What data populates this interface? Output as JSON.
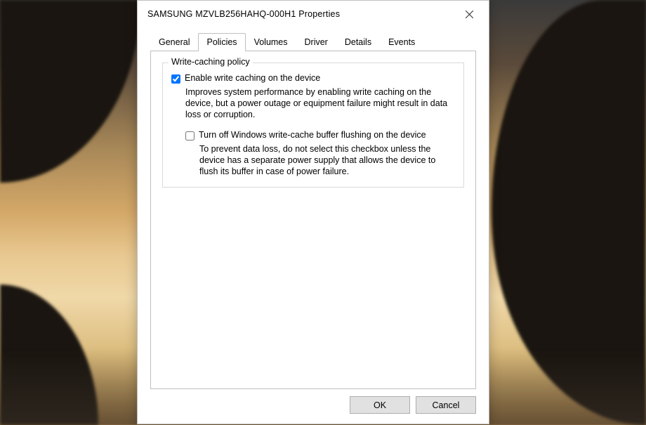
{
  "window": {
    "title": "SAMSUNG MZVLB256HAHQ-000H1 Properties"
  },
  "tabs": {
    "general": "General",
    "policies": "Policies",
    "volumes": "Volumes",
    "driver": "Driver",
    "details": "Details",
    "events": "Events",
    "active_index": 1
  },
  "group": {
    "title": "Write-caching policy",
    "enable": {
      "checked": true,
      "label": "Enable write caching on the device",
      "desc": "Improves system performance by enabling write caching on the device, but a power outage or equipment failure might result in data loss or corruption."
    },
    "turnoff": {
      "checked": false,
      "label": "Turn off Windows write-cache buffer flushing on the device",
      "desc": "To prevent data loss, do not select this checkbox unless the device has a separate power supply that allows the device to flush its buffer in case of power failure."
    }
  },
  "buttons": {
    "ok": "OK",
    "cancel": "Cancel"
  }
}
